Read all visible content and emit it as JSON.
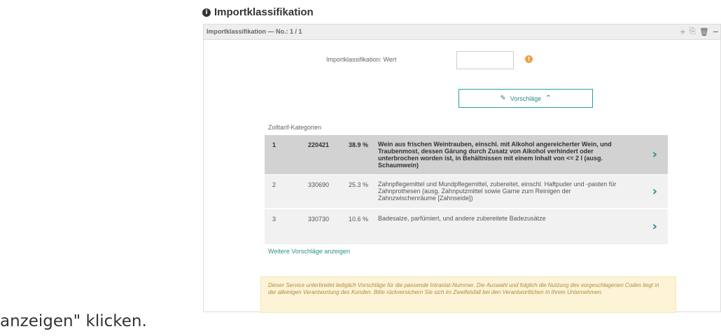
{
  "section": {
    "title": "Importklassifikation",
    "info_icon": "info-circle-icon"
  },
  "panel": {
    "header_label": "Importklassifikation — No.: 1 / 1",
    "tools": [
      "plus-icon",
      "copy-icon",
      "trash-icon",
      "minus-icon"
    ]
  },
  "field": {
    "label": "Importklassifikation: Wert",
    "value": "",
    "warning_icon": "warning-icon"
  },
  "suggest_button": {
    "label": "Vorschläge",
    "icon": "pencil-icon",
    "chevron": "chevron-up-icon"
  },
  "categories": {
    "label": "Zolltarif-Kategorien",
    "rows": [
      {
        "rank": "1",
        "code": "220421",
        "pct": "38.9 %",
        "desc": "Wein aus frischen Weintrauben, einschl. mit Alkohol angereicherter Wein, und Traubenmost, dessen Gärung durch Zusatz von Alkohol verhindert oder unterbrochen worden ist, in Behältnissen mit einem Inhalt von <= 2 l (ausg. Schaumwein)"
      },
      {
        "rank": "2",
        "code": "330690",
        "pct": "25.3 %",
        "desc": "Zahnpflegemittel und Mundpflegemittel, zubereitet, einschl. Haftpuder und -pasten für Zahnprothesen (ausg. Zahnputzmittel sowie Garne zum Reinigen der Zahnzwischenräume [Zahnseide])"
      },
      {
        "rank": "3",
        "code": "330730",
        "pct": "10.6 %",
        "desc": "Badesalze, parfümiert, und andere zubereitete Badezusätze"
      }
    ]
  },
  "more_link": "Weitere Vorschläge anzeigen",
  "disclaimer": "Dieser Service unterbreitet lediglich Vorschläge für die passende Intrastat-Nummer. Die Auswahl und folglich die Nutzung des vorgeschlagenen Codes liegt in der alleinigen Verantwortung des Kunden. Bitte rückversichern Sie sich im Zweifelsfall bei den Verantwortlichen in Ihrem Unternehmen.",
  "caption": "anzeigen\" klicken."
}
